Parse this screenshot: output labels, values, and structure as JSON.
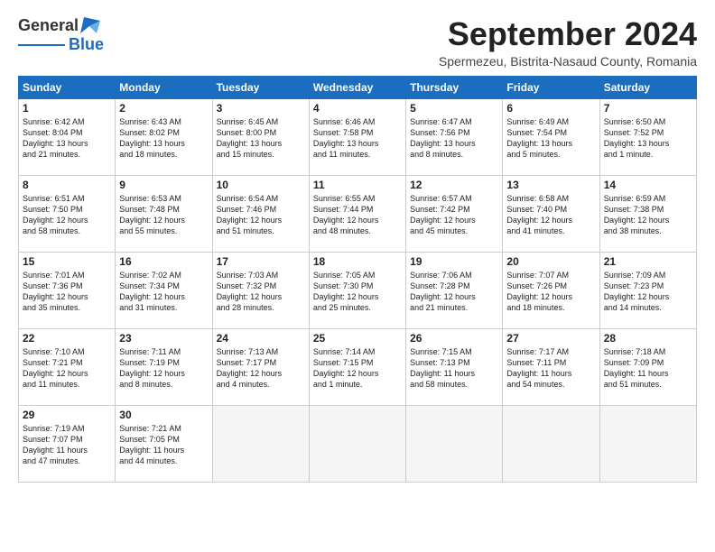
{
  "header": {
    "logo_general": "General",
    "logo_blue": "Blue",
    "month_title": "September 2024",
    "location": "Spermezeu, Bistrita-Nasaud County, Romania"
  },
  "weekdays": [
    "Sunday",
    "Monday",
    "Tuesday",
    "Wednesday",
    "Thursday",
    "Friday",
    "Saturday"
  ],
  "weeks": [
    [
      {
        "day": "1",
        "info": "Sunrise: 6:42 AM\nSunset: 8:04 PM\nDaylight: 13 hours\nand 21 minutes."
      },
      {
        "day": "2",
        "info": "Sunrise: 6:43 AM\nSunset: 8:02 PM\nDaylight: 13 hours\nand 18 minutes."
      },
      {
        "day": "3",
        "info": "Sunrise: 6:45 AM\nSunset: 8:00 PM\nDaylight: 13 hours\nand 15 minutes."
      },
      {
        "day": "4",
        "info": "Sunrise: 6:46 AM\nSunset: 7:58 PM\nDaylight: 13 hours\nand 11 minutes."
      },
      {
        "day": "5",
        "info": "Sunrise: 6:47 AM\nSunset: 7:56 PM\nDaylight: 13 hours\nand 8 minutes."
      },
      {
        "day": "6",
        "info": "Sunrise: 6:49 AM\nSunset: 7:54 PM\nDaylight: 13 hours\nand 5 minutes."
      },
      {
        "day": "7",
        "info": "Sunrise: 6:50 AM\nSunset: 7:52 PM\nDaylight: 13 hours\nand 1 minute."
      }
    ],
    [
      {
        "day": "8",
        "info": "Sunrise: 6:51 AM\nSunset: 7:50 PM\nDaylight: 12 hours\nand 58 minutes."
      },
      {
        "day": "9",
        "info": "Sunrise: 6:53 AM\nSunset: 7:48 PM\nDaylight: 12 hours\nand 55 minutes."
      },
      {
        "day": "10",
        "info": "Sunrise: 6:54 AM\nSunset: 7:46 PM\nDaylight: 12 hours\nand 51 minutes."
      },
      {
        "day": "11",
        "info": "Sunrise: 6:55 AM\nSunset: 7:44 PM\nDaylight: 12 hours\nand 48 minutes."
      },
      {
        "day": "12",
        "info": "Sunrise: 6:57 AM\nSunset: 7:42 PM\nDaylight: 12 hours\nand 45 minutes."
      },
      {
        "day": "13",
        "info": "Sunrise: 6:58 AM\nSunset: 7:40 PM\nDaylight: 12 hours\nand 41 minutes."
      },
      {
        "day": "14",
        "info": "Sunrise: 6:59 AM\nSunset: 7:38 PM\nDaylight: 12 hours\nand 38 minutes."
      }
    ],
    [
      {
        "day": "15",
        "info": "Sunrise: 7:01 AM\nSunset: 7:36 PM\nDaylight: 12 hours\nand 35 minutes."
      },
      {
        "day": "16",
        "info": "Sunrise: 7:02 AM\nSunset: 7:34 PM\nDaylight: 12 hours\nand 31 minutes."
      },
      {
        "day": "17",
        "info": "Sunrise: 7:03 AM\nSunset: 7:32 PM\nDaylight: 12 hours\nand 28 minutes."
      },
      {
        "day": "18",
        "info": "Sunrise: 7:05 AM\nSunset: 7:30 PM\nDaylight: 12 hours\nand 25 minutes."
      },
      {
        "day": "19",
        "info": "Sunrise: 7:06 AM\nSunset: 7:28 PM\nDaylight: 12 hours\nand 21 minutes."
      },
      {
        "day": "20",
        "info": "Sunrise: 7:07 AM\nSunset: 7:26 PM\nDaylight: 12 hours\nand 18 minutes."
      },
      {
        "day": "21",
        "info": "Sunrise: 7:09 AM\nSunset: 7:23 PM\nDaylight: 12 hours\nand 14 minutes."
      }
    ],
    [
      {
        "day": "22",
        "info": "Sunrise: 7:10 AM\nSunset: 7:21 PM\nDaylight: 12 hours\nand 11 minutes."
      },
      {
        "day": "23",
        "info": "Sunrise: 7:11 AM\nSunset: 7:19 PM\nDaylight: 12 hours\nand 8 minutes."
      },
      {
        "day": "24",
        "info": "Sunrise: 7:13 AM\nSunset: 7:17 PM\nDaylight: 12 hours\nand 4 minutes."
      },
      {
        "day": "25",
        "info": "Sunrise: 7:14 AM\nSunset: 7:15 PM\nDaylight: 12 hours\nand 1 minute."
      },
      {
        "day": "26",
        "info": "Sunrise: 7:15 AM\nSunset: 7:13 PM\nDaylight: 11 hours\nand 58 minutes."
      },
      {
        "day": "27",
        "info": "Sunrise: 7:17 AM\nSunset: 7:11 PM\nDaylight: 11 hours\nand 54 minutes."
      },
      {
        "day": "28",
        "info": "Sunrise: 7:18 AM\nSunset: 7:09 PM\nDaylight: 11 hours\nand 51 minutes."
      }
    ],
    [
      {
        "day": "29",
        "info": "Sunrise: 7:19 AM\nSunset: 7:07 PM\nDaylight: 11 hours\nand 47 minutes."
      },
      {
        "day": "30",
        "info": "Sunrise: 7:21 AM\nSunset: 7:05 PM\nDaylight: 11 hours\nand 44 minutes."
      },
      null,
      null,
      null,
      null,
      null
    ]
  ]
}
